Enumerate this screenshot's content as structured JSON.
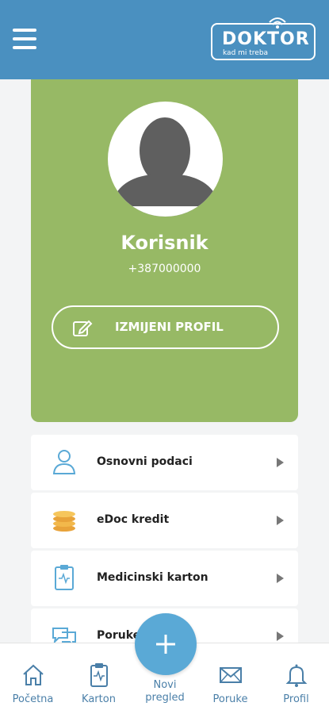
{
  "header": {
    "logo_main": "DOKTOR",
    "logo_sub": "kad mi treba",
    "accent_color": "#4a90c0"
  },
  "profile": {
    "name": "Korisnik",
    "phone": "+387000000",
    "edit_label": "IZMIJENI PROFIL",
    "card_color": "#97b965"
  },
  "menu": {
    "items": [
      {
        "label": "Osnovni podaci",
        "icon": "user-icon"
      },
      {
        "label": "eDoc kredit",
        "icon": "coins-icon"
      },
      {
        "label": "Medicinski karton",
        "icon": "clipboard-icon"
      },
      {
        "label": "Poruke",
        "icon": "chat-icon"
      }
    ]
  },
  "tabbar": {
    "tabs": [
      {
        "label": "Početna",
        "icon": "home-icon"
      },
      {
        "label": "Karton",
        "icon": "clipboard-icon"
      },
      {
        "label": "Novi pregled",
        "icon": "plus-icon"
      },
      {
        "label": "Poruke",
        "icon": "mail-icon"
      },
      {
        "label": "Profil",
        "icon": "bell-icon"
      }
    ],
    "new_exam_line1": "Novi",
    "new_exam_line2": "pregled"
  }
}
